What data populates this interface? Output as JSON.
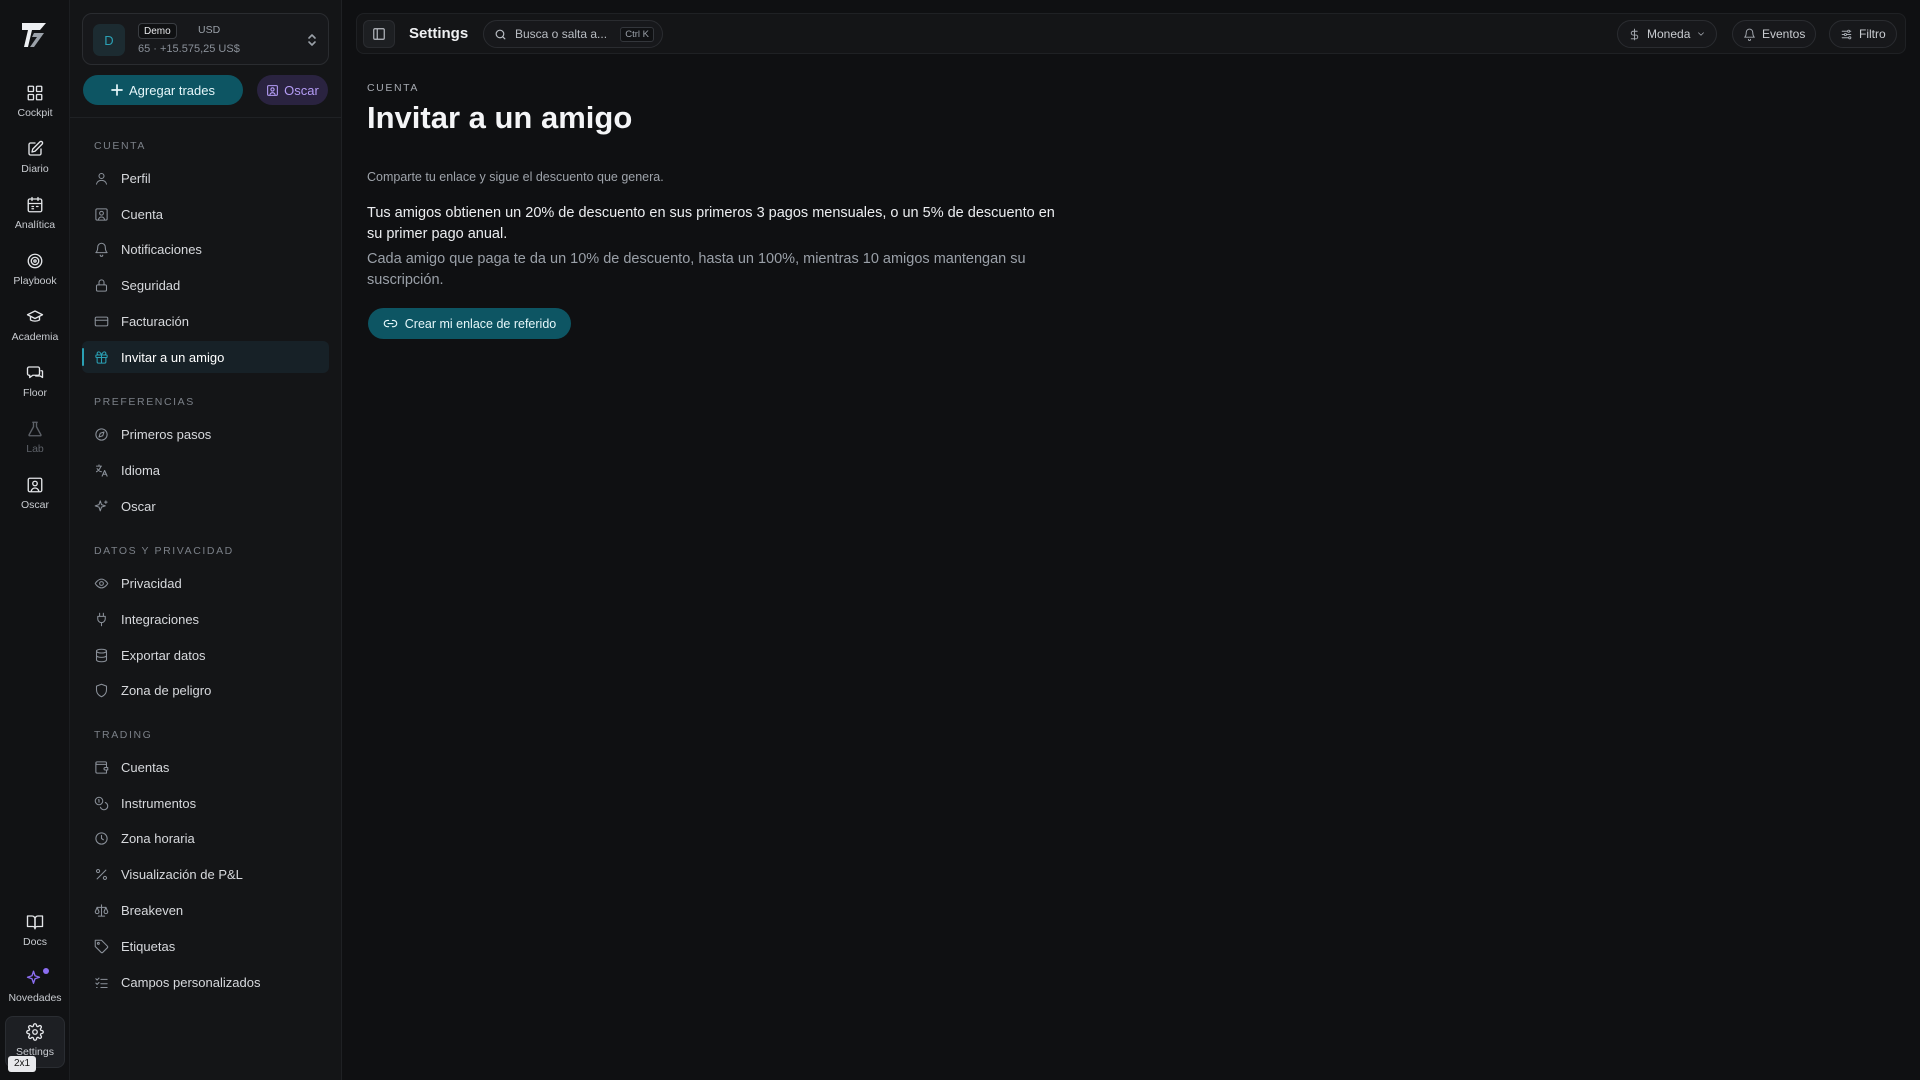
{
  "rail": {
    "items": [
      {
        "label": "Cockpit",
        "icon": "grid-icon"
      },
      {
        "label": "Diario",
        "icon": "edit-icon"
      },
      {
        "label": "Analítica",
        "icon": "calendar-icon"
      },
      {
        "label": "Playbook",
        "icon": "target-icon"
      },
      {
        "label": "Academia",
        "icon": "graduation-cap-icon"
      },
      {
        "label": "Floor",
        "icon": "chat-icon"
      },
      {
        "label": "Lab",
        "icon": "flask-icon"
      },
      {
        "label": "Oscar",
        "icon": "portrait-icon"
      }
    ],
    "bottom": [
      {
        "label": "Docs",
        "icon": "book-icon"
      },
      {
        "label": "Novedades",
        "icon": "sparkles-icon"
      },
      {
        "label": "Settings",
        "icon": "gear-icon"
      }
    ],
    "shortcut_badge": "2x1"
  },
  "account": {
    "avatar": "D",
    "mode": "Demo",
    "currency": "USD",
    "stats": "65 · +15.575,25 US$"
  },
  "sidebar": {
    "add_trades": "Agregar trades",
    "oscar": "Oscar",
    "sections": [
      {
        "title": "CUENTA",
        "items": [
          "Perfil",
          "Cuenta",
          "Notificaciones",
          "Seguridad",
          "Facturación",
          "Invitar a un amigo"
        ]
      },
      {
        "title": "PREFERENCIAS",
        "items": [
          "Primeros pasos",
          "Idioma",
          "Oscar"
        ]
      },
      {
        "title": "DATOS Y PRIVACIDAD",
        "items": [
          "Privacidad",
          "Integraciones",
          "Exportar datos",
          "Zona de peligro"
        ]
      },
      {
        "title": "TRADING",
        "items": [
          "Cuentas",
          "Instrumentos",
          "Zona horaria",
          "Visualización de P&L",
          "Breakeven",
          "Etiquetas",
          "Campos personalizados"
        ]
      }
    ],
    "active_item": "Invitar a un amigo"
  },
  "topbar": {
    "title": "Settings",
    "search_placeholder": "Busca o salta a...",
    "search_shortcut": "Ctrl K",
    "moneda": "Moneda",
    "eventos": "Eventos",
    "filtro": "Filtro"
  },
  "main": {
    "kicker": "CUENTA",
    "title": "Invitar a un amigo",
    "subtitle": "Comparte tu enlace y sigue el descuento que genera.",
    "para1": "Tus amigos obtienen un 20% de descuento en sus primeros 3 pagos mensuales, o un 5% de descuento en su primer pago anual.",
    "para2": "Cada amigo que paga te da un 10% de descuento, hasta un 100%, mientras 10 amigos mantengan su suscripción.",
    "cta": "Crear mi enlace de referido"
  },
  "colors": {
    "accent": "#0d5563",
    "accent_text": "#2aa0b4",
    "oscar_purple": "#b49cf5",
    "background": "#0f1012"
  }
}
